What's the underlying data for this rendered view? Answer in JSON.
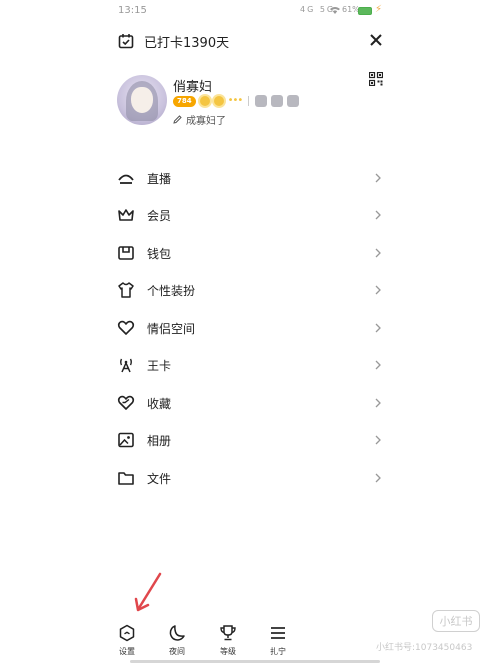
{
  "status_bar": {
    "time": "13:15",
    "network": "4G 5G",
    "battery_percent": "61%"
  },
  "header": {
    "checkin_text": "已打卡1390天"
  },
  "profile": {
    "nickname": "俏寡妇",
    "level": "784",
    "signature": "成寡妇了"
  },
  "menu": [
    {
      "label": "直播",
      "icon": "live-icon"
    },
    {
      "label": "会员",
      "icon": "crown-icon"
    },
    {
      "label": "钱包",
      "icon": "wallet-icon"
    },
    {
      "label": "个性装扮",
      "icon": "shirt-icon"
    },
    {
      "label": "情侣空间",
      "icon": "heart-icon"
    },
    {
      "label": "王卡",
      "icon": "signal-tower-icon"
    },
    {
      "label": "收藏",
      "icon": "favorite-icon"
    },
    {
      "label": "相册",
      "icon": "photo-album-icon"
    },
    {
      "label": "文件",
      "icon": "folder-icon"
    }
  ],
  "bottom_tabs": [
    {
      "label": "设置",
      "icon": "settings-icon"
    },
    {
      "label": "夜间",
      "icon": "moon-icon"
    },
    {
      "label": "等级",
      "icon": "trophy-icon"
    },
    {
      "label": "扎宁",
      "icon": "menu-icon"
    }
  ],
  "watermark": {
    "logo": "小红书",
    "text": "小红书号:1073450463"
  },
  "colors": {
    "accent_level": "#f7a600",
    "sun": "#f4c542",
    "arrow": "#e0474c"
  }
}
